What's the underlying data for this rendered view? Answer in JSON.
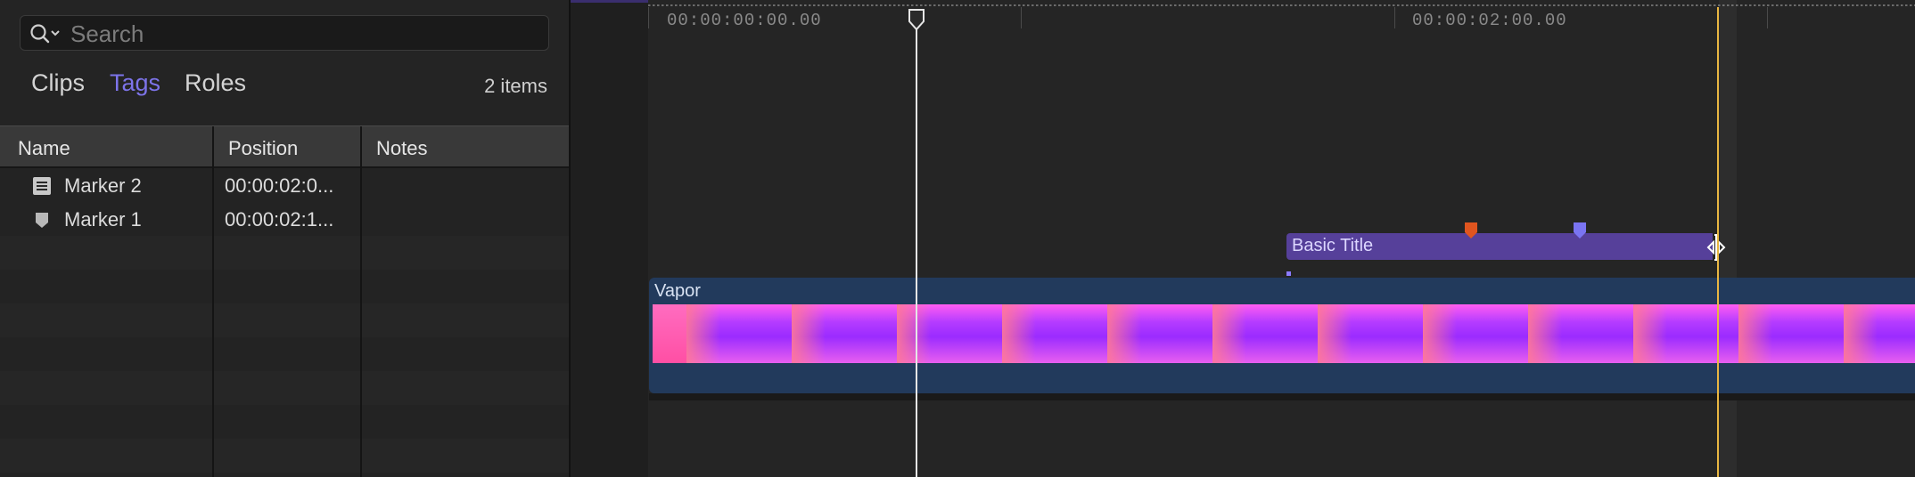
{
  "search": {
    "placeholder": "Search"
  },
  "tabs": [
    {
      "label": "Clips",
      "active": false
    },
    {
      "label": "Tags",
      "active": true
    },
    {
      "label": "Roles",
      "active": false
    }
  ],
  "item_count": "2 items",
  "table": {
    "columns": [
      "Name",
      "Position",
      "Notes"
    ],
    "rows": [
      {
        "icon": "list-marker-icon",
        "name": "Marker 2",
        "position": "00:00:02:0...",
        "notes": ""
      },
      {
        "icon": "marker-icon",
        "name": "Marker 1",
        "position": "00:00:02:1...",
        "notes": ""
      }
    ]
  },
  "timeline": {
    "timecodes": [
      "00:00:00:00.00",
      "00:00:02:00.00"
    ],
    "title_clip": {
      "label": "Basic Title",
      "color": "#56409a"
    },
    "video_clip": {
      "label": "Vapor",
      "color": "#223a5c"
    },
    "playhead_color": "#e6e6e6",
    "skimmer_color": "#e8b641"
  },
  "colors": {
    "accent": "#7d74ea",
    "marker_orange": "#e0551f",
    "marker_blue": "#7a74f2"
  }
}
